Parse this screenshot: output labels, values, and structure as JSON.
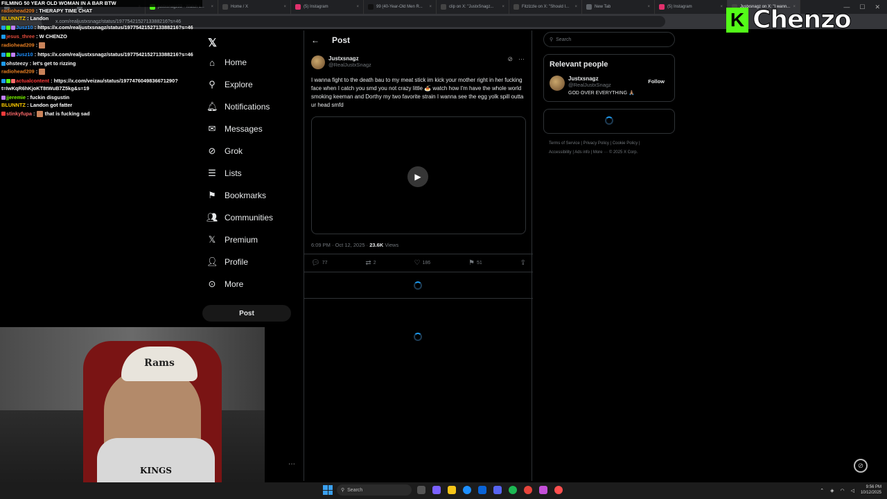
{
  "browser": {
    "tabs": [
      {
        "label": "",
        "color": "#5f6368",
        "icon": "blank-icon"
      },
      {
        "label": "",
        "color": "#5f6368",
        "icon": "blank-icon"
      },
      {
        "label": "justxsnagz33 - Watch c...",
        "color": "#53fc18",
        "icon": "kick-icon"
      },
      {
        "label": "Home / X",
        "color": "#444",
        "icon": "x-icon"
      },
      {
        "label": "(5) Instagram",
        "color": "#e1306c",
        "icon": "instagram-icon"
      },
      {
        "label": "99 (40-Year-Old Men R...",
        "color": "#111",
        "icon": "tiktok-icon"
      },
      {
        "label": "clip on X: \"JustxSnagz...",
        "color": "#444",
        "icon": "x-icon"
      },
      {
        "label": "Fitzlzzle on X: \"Should I...",
        "color": "#444",
        "icon": "x-icon"
      },
      {
        "label": "New Tab",
        "color": "#5f6368",
        "icon": "newtab-icon"
      },
      {
        "label": "(5) Instagram",
        "color": "#e1306c",
        "icon": "instagram-icon"
      },
      {
        "label": "Justxsnagz on X: \"I wann...",
        "color": "#444",
        "icon": "x-icon"
      }
    ],
    "url": "x.com/realjustxsnagz/status/1977542152713388216?s=46"
  },
  "chat": {
    "banner": "FILMING 50 YEAR OLD WOMAN IN A BAR BTW",
    "lines": [
      {
        "user": "radiohead209",
        "color": "#e67e22",
        "text": "THERAPY TIME CHAT",
        "badges": []
      },
      {
        "user": "BLUNNTZ",
        "color": "#ffcc00",
        "text": "Landon",
        "badges": []
      },
      {
        "user": "Jusz10",
        "color": "#1e90ff",
        "text": "https://x.com/realjustxsnagz/status/1977542152713388216?s=46",
        "badges": [
          "#1d9bf0",
          "#53fc18",
          "#c080ff"
        ],
        "wrap": true
      },
      {
        "user": "jesus_three",
        "color": "#e74c3c",
        "text": "W CHENZO",
        "badges": [
          "#1d9bf0"
        ]
      },
      {
        "user": "radiohead209",
        "color": "#e67e22",
        "text": "",
        "badges": [],
        "emote": true
      },
      {
        "user": "Jusz10",
        "color": "#1e90ff",
        "text": "https://x.com/realjustxsnagz/status/1977542152713388216?s=46",
        "badges": [
          "#1d9bf0",
          "#53fc18",
          "#c080ff"
        ],
        "wrap": true
      },
      {
        "user": "ohsteezy",
        "color": "#eeeeee",
        "text": "let's get to rizzing",
        "badges": [
          "#1d9bf0"
        ]
      },
      {
        "user": "radiohead209",
        "color": "#e67e22",
        "text": "",
        "badges": [],
        "emote": true
      },
      {
        "user": "actualcontent",
        "color": "#ff3b3b",
        "text": "https://x.com/veizau/status/1977476049836671290?t=IwKqR6hKjoKT8tWuB7Z5kg&s=19",
        "badges": [
          "#1d9bf0",
          "#53fc18",
          "#ff6b6b"
        ],
        "wrap": true
      },
      {
        "user": "jjeremie",
        "color": "#7cfc00",
        "text": "fuckin disgustin",
        "badges": [
          "#c080ff"
        ]
      },
      {
        "user": "BLUNNTZ",
        "color": "#ffcc00",
        "text": "Landon got fatter",
        "badges": []
      },
      {
        "user": "stinkyfupa",
        "color": "#ff6b6b",
        "text": "that is fucking sad",
        "badges": [
          "#ff3b3b"
        ],
        "emote": true
      }
    ]
  },
  "nav": {
    "items": [
      {
        "label": "Home",
        "icon": "home-icon"
      },
      {
        "label": "Explore",
        "icon": "search-icon"
      },
      {
        "label": "Notifications",
        "icon": "bell-icon"
      },
      {
        "label": "Messages",
        "icon": "mail-icon"
      },
      {
        "label": "Grok",
        "icon": "grok-icon"
      },
      {
        "label": "Lists",
        "icon": "list-icon"
      },
      {
        "label": "Bookmarks",
        "icon": "bookmark-icon"
      },
      {
        "label": "Communities",
        "icon": "people-icon"
      },
      {
        "label": "Premium",
        "icon": "x-icon"
      },
      {
        "label": "Profile",
        "icon": "person-icon"
      },
      {
        "label": "More",
        "icon": "more-circle-icon"
      }
    ],
    "post_button": "Post"
  },
  "post": {
    "header": "Post",
    "author_name": "Justxsnagz",
    "author_handle": "@RealJustxSnagz",
    "text": "I wanna fight to the death bau to my meat stick im kick your mother right in her fucking face when I catch you smd you not crazy little 🍝 watch how I'm have the whole world smoking keeman and Dorthy my two favorite strain I wanna see the egg yolk spill outta ur head smfd",
    "time": "6:09 PM · Oct 12, 2025 · ",
    "views_count": "23.6K",
    "views_label": " Views",
    "replies": "77",
    "reposts": "2",
    "likes": "186",
    "bookmarks": "51"
  },
  "right": {
    "search_placeholder": "Search",
    "relevant_title": "Relevant people",
    "person_name": "Justxsnagz",
    "person_handle": "@RealJustxSnagz",
    "person_bio": "GOD OVER EVERYTHING 🙏🏽",
    "follow_label": "Follow",
    "footer": {
      "terms": "Terms of Service",
      "privacy": "Privacy Policy",
      "cookie": "Cookie Policy",
      "accessibility": "Accessibility",
      "ads": "Ads info",
      "more": "More ···",
      "copyright": "© 2025 X Corp."
    }
  },
  "stream": {
    "brand_name": "Chenzo",
    "brand_color": "#53fc18",
    "cap_text": "Rams",
    "shirt_text": "KINGS"
  },
  "taskbar": {
    "search_label": "Search",
    "time": "9:56 PM",
    "date": "10/12/2025"
  }
}
